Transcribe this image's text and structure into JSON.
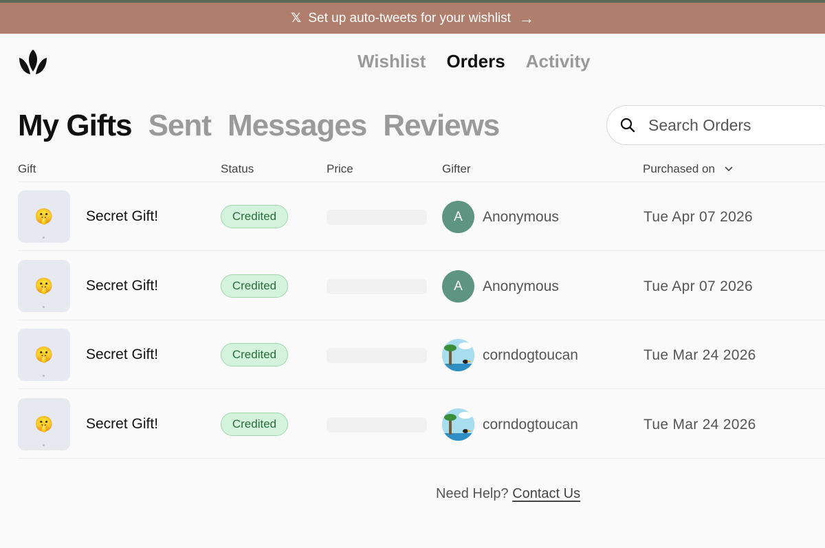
{
  "banner": {
    "text": "Set up auto-tweets for your wishlist",
    "icon": "x-logo-icon",
    "arrow": "arrow-right-icon"
  },
  "topnav": {
    "items": [
      "Wishlist",
      "Orders",
      "Activity"
    ],
    "active": "Orders"
  },
  "subtabs": {
    "items": [
      "My Gifts",
      "Sent",
      "Messages",
      "Reviews"
    ],
    "active": "My Gifts"
  },
  "search": {
    "placeholder": "Search Orders"
  },
  "columns": {
    "gift": "Gift",
    "status": "Status",
    "price": "Price",
    "gifter": "Gifter",
    "purchased": "Purchased on"
  },
  "orders": [
    {
      "emoji": "🤫",
      "name": "Secret Gift!",
      "status": "Credited",
      "avatar_letter": "A",
      "gifter": "Anonymous",
      "date": "Tue Apr 07 2026"
    },
    {
      "emoji": "🤫",
      "name": "Secret Gift!",
      "status": "Credited",
      "avatar_letter": "A",
      "gifter": "Anonymous",
      "date": "Tue Apr 07 2026"
    },
    {
      "emoji": "🤫",
      "name": "Secret Gift!",
      "status": "Credited",
      "avatar_letter": "",
      "gifter": "corndogtoucan",
      "date": "Tue Mar 24 2026"
    },
    {
      "emoji": "🤫",
      "name": "Secret Gift!",
      "status": "Credited",
      "avatar_letter": "",
      "gifter": "corndogtoucan",
      "date": "Tue Mar 24 2026"
    }
  ],
  "help": {
    "prefix": "Need Help?",
    "link": "Contact Us"
  },
  "colors": {
    "banner": "#b07e6c",
    "badge_bg": "#d3f3dc",
    "badge_text": "#2b6b3c",
    "avatar": "#5e9482"
  }
}
